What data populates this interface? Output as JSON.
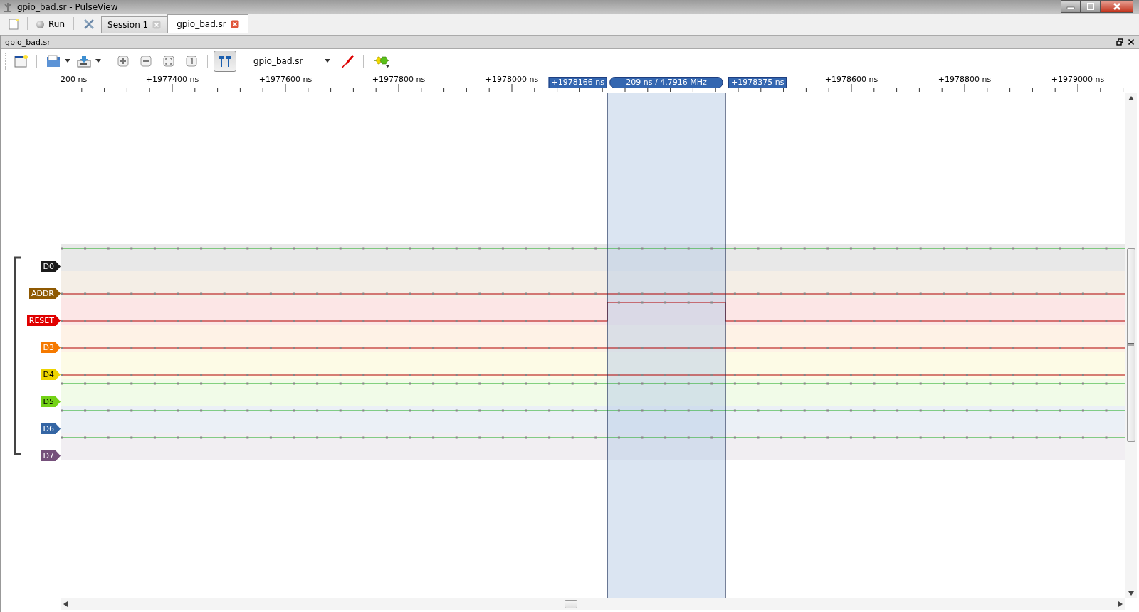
{
  "window": {
    "title": "gpio_bad.sr - PulseView"
  },
  "main_toolbar": {
    "run_label": "Run"
  },
  "tabs": [
    {
      "label": "Session 1",
      "selected": false
    },
    {
      "label": "gpio_bad.sr",
      "selected": true
    }
  ],
  "session": {
    "title": "gpio_bad.sr",
    "device": "gpio_bad.sr",
    "cursors_on": true
  },
  "ruler": {
    "labels": [
      "200 ns",
      "+1977400 ns",
      "+1977600 ns",
      "+1977800 ns",
      "+1978000 ns",
      "+1978600 ns",
      "+1978800 ns",
      "+1979000 ns"
    ]
  },
  "cursors": {
    "left": "+1978166 ns",
    "span": "209 ns / 4.7916 MHz",
    "right": "+1978375 ns"
  },
  "channels": [
    {
      "name": "D0",
      "color": "#1b1b1b",
      "kind": "high"
    },
    {
      "name": "ADDR",
      "color": "#8f5902",
      "kind": "low"
    },
    {
      "name": "RESET",
      "color": "#e00000",
      "kind": "pulse"
    },
    {
      "name": "D3",
      "color": "#f57900",
      "kind": "low"
    },
    {
      "name": "D4",
      "color": "#edd400",
      "kind": "low"
    },
    {
      "name": "D5",
      "color": "#73d216",
      "kind": "high"
    },
    {
      "name": "D6",
      "color": "#3465a4",
      "kind": "high"
    },
    {
      "name": "D7",
      "color": "#75507b",
      "kind": "high"
    }
  ]
}
